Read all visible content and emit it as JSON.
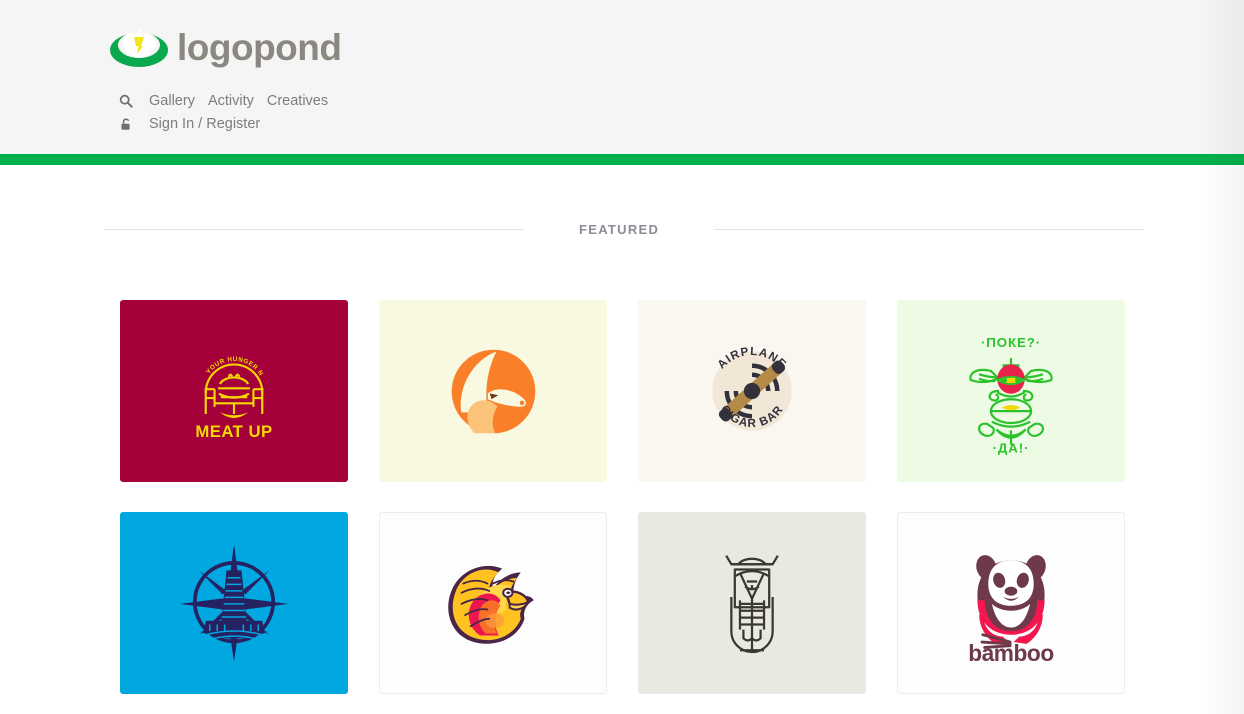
{
  "site": {
    "brand_name": "logopond",
    "brand_colors": {
      "pad_green": "#0ba94d",
      "flower_white": "#ffffff",
      "center_yellow": "#f2e41b",
      "wordmark": "#8b8781"
    },
    "accent_bar_color": "#00b04a",
    "header_background": "#f5f5f5"
  },
  "nav": {
    "search_icon": "search-icon",
    "lock_icon": "lock-icon",
    "primary": [
      {
        "label": "Gallery",
        "name": "nav-gallery"
      },
      {
        "label": "Activity",
        "name": "nav-activity"
      },
      {
        "label": "Creatives",
        "name": "nav-creatives"
      }
    ],
    "account": {
      "label": "Sign In / Register",
      "name": "nav-sign-in-register"
    }
  },
  "section": {
    "featured_heading": "FEATURED"
  },
  "gallery": {
    "items": [
      {
        "id": "meat-up",
        "name": "logo-card-meat-up",
        "title": "MEAT UP",
        "tagline": "MEET YOUR HUNGER NEEDS",
        "background": "#a4003a",
        "mark_color": "#f5d800",
        "description": "burger between two chairs with arched tagline",
        "bordered": false
      },
      {
        "id": "fox",
        "name": "logo-card-fox",
        "title": "",
        "background": "#f9f8e0",
        "mark_color": "#f97f28",
        "mark_color_secondary": "#fbc27a",
        "description": "fox head inside circle",
        "bordered": false
      },
      {
        "id": "airplane-cigar-bar",
        "name": "logo-card-airplane-cigar-bar",
        "title": "AIRPLANE CIGAR BAR",
        "title_top": "AIRPLANE",
        "title_bottom": "CIGAR BAR",
        "background": "#faf6f0",
        "badge_color": "#f2e6d6",
        "mark_color": "#32313c",
        "cigar_color": "#b58a46",
        "description": "circular propeller badge with diagonal cigar",
        "bordered": false
      },
      {
        "id": "poke-da",
        "name": "logo-card-poke-da",
        "title_top": "·ПОКЕ?·",
        "title_bottom": "·ДА!·",
        "background": "#eefbe4",
        "mark_color": "#2cc22c",
        "accent_color": "#e8234a",
        "accent_color_2": "#f5d800",
        "description": "winged creature line mark with Cyrillic text",
        "bordered": false
      },
      {
        "id": "skyscraper-compass",
        "name": "logo-card-skyscraper-compass",
        "title": "",
        "background": "#00a7e1",
        "mark_color": "#262262",
        "description": "skyscraper inside compass star",
        "bordered": false
      },
      {
        "id": "phoenix-mascot",
        "name": "logo-card-phoenix-mascot",
        "title": "",
        "background": "#fdfdfd",
        "mark_color": "#ffc220",
        "mark_color_secondary": "#ed1651",
        "outline_color": "#4a2545",
        "description": "phoenix eagle mascot head",
        "bordered": true
      },
      {
        "id": "microphone-totem",
        "name": "logo-card-microphone-totem",
        "title": "",
        "background": "#e9e8e1",
        "mark_color": "#3a3833",
        "description": "line art microphone with face and hat",
        "bordered": false
      },
      {
        "id": "bamboo",
        "name": "logo-card-bamboo",
        "title": "bamboo",
        "background": "#fdfdfd",
        "mark_color": "#6e3a4a",
        "accent_color": "#f4174f",
        "description": "panda holding bamboo stalks above wordmark",
        "bordered": true
      }
    ]
  }
}
